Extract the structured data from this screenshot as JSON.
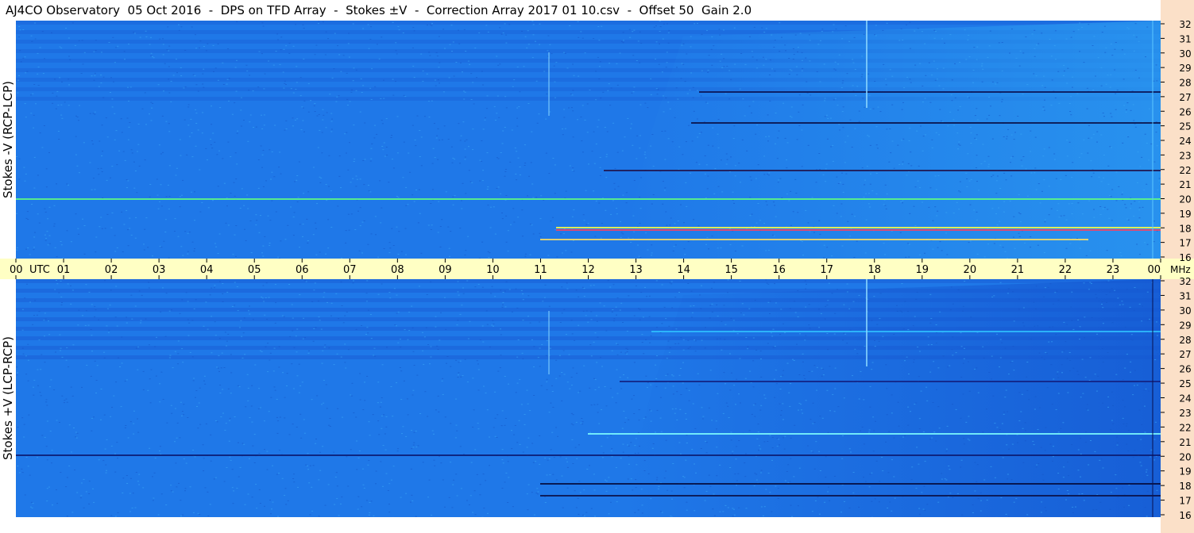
{
  "title": "AJ4CO Observatory  05 Oct 2016  -  DPS on TFD Array  -  Stokes ±V  -  Correction Array 2017 01 10.csv  -  Offset 50  Gain 2.0",
  "colors": {
    "background": "#1f78e8",
    "axis_band": "#ffffc4",
    "freq_strip": "#fbe0c8"
  },
  "chart_data": [
    {
      "type": "heatmap",
      "title": "",
      "ylabel": "Stokes -V (RCP-LCP)",
      "xlabel": "UTC",
      "x_ticks": [
        "00",
        "01",
        "02",
        "03",
        "04",
        "05",
        "06",
        "07",
        "08",
        "09",
        "10",
        "11",
        "12",
        "13",
        "14",
        "15",
        "16",
        "17",
        "18",
        "19",
        "20",
        "21",
        "22",
        "23",
        "00"
      ],
      "y_ticks": [
        32,
        31,
        30,
        29,
        28,
        27,
        26,
        25,
        24,
        23,
        22,
        21,
        20,
        19,
        18,
        17,
        16
      ],
      "y_unit": "MHz",
      "xlim": [
        0,
        24
      ],
      "ylim": [
        16,
        32
      ]
    },
    {
      "type": "heatmap",
      "title": "",
      "ylabel": "Stokes +V (LCP-RCP)",
      "xlabel": "UTC",
      "x_ticks": [
        "00",
        "01",
        "02",
        "03",
        "04",
        "05",
        "06",
        "07",
        "08",
        "09",
        "10",
        "11",
        "12",
        "13",
        "14",
        "15",
        "16",
        "17",
        "18",
        "19",
        "20",
        "21",
        "22",
        "23",
        "00"
      ],
      "y_ticks": [
        32,
        31,
        30,
        29,
        28,
        27,
        26,
        25,
        24,
        23,
        22,
        21,
        20,
        19,
        18,
        17,
        16
      ],
      "y_unit": "MHz",
      "xlim": [
        0,
        24
      ],
      "ylim": [
        16,
        32
      ]
    }
  ],
  "axis": {
    "utc_label": "UTC",
    "mhz_label": "MHz"
  }
}
